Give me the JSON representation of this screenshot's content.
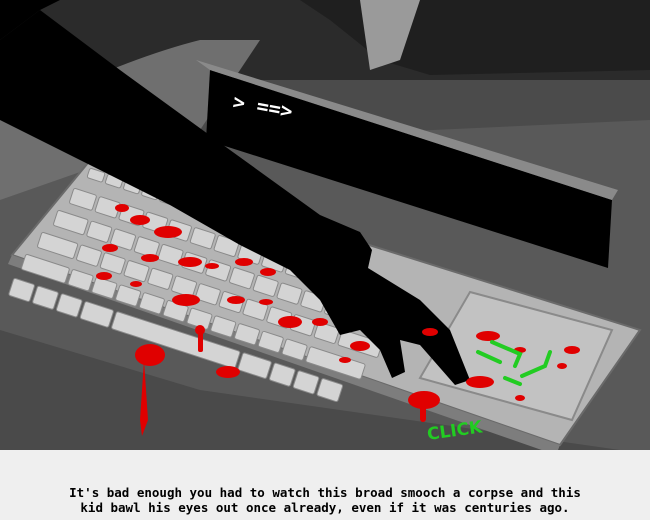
{
  "panel": {
    "screen_prompt": ">  ==>",
    "sound_effect": "CLICK",
    "colors": {
      "blood": "#e00000",
      "sfx": "#22cc22",
      "screen": "#000000",
      "keyboard": "#c8c8c8"
    }
  },
  "caption": {
    "line1": "It's bad enough you had to watch this broad smooch a corpse and this",
    "line2": "kid bawl his eyes out once already, even if it was centuries ago."
  }
}
